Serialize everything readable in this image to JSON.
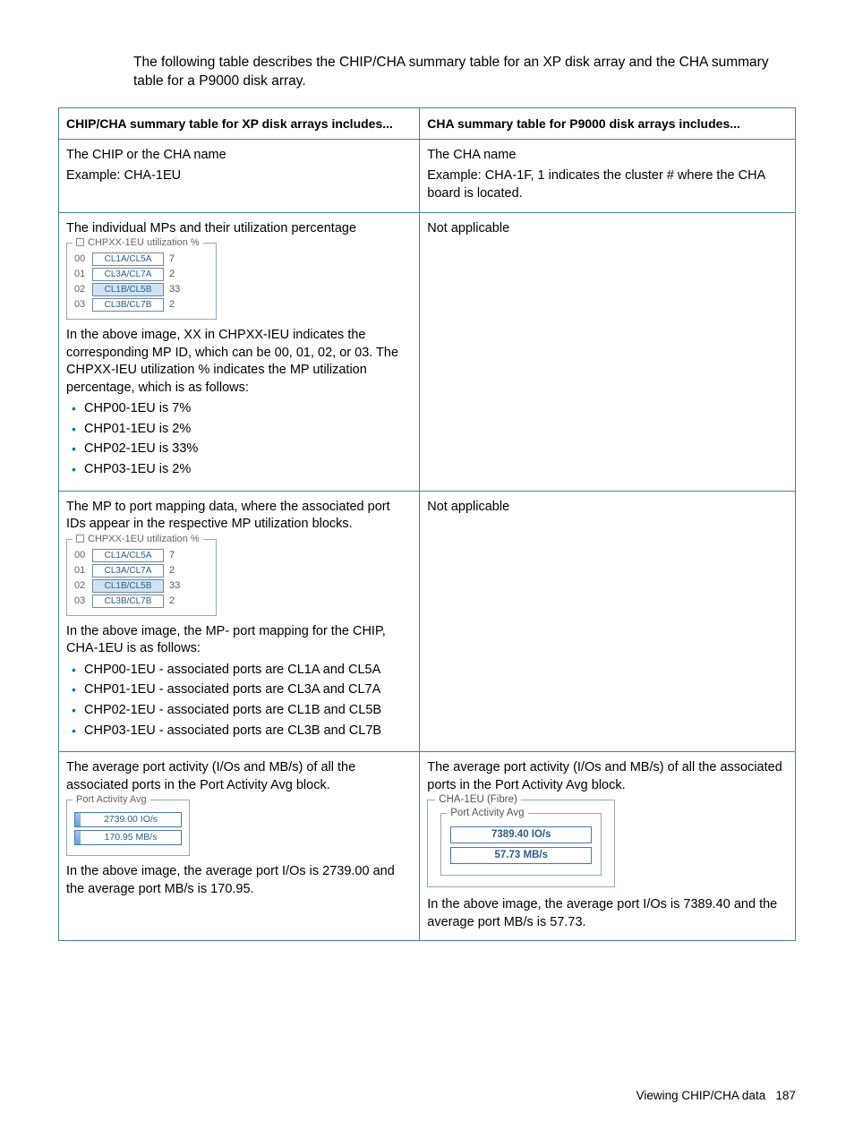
{
  "intro": "The following table describes the CHIP/CHA summary table for an XP disk array and the CHA summary table for a P9000 disk array.",
  "headers": {
    "left": "CHIP/CHA summary table for XP disk arrays includes...",
    "right": "CHA summary table for P9000 disk arrays includes..."
  },
  "row1": {
    "left_line1": "The CHIP or the CHA name",
    "left_line2": "Example: CHA-1EU",
    "right_line1": "The CHA name",
    "right_line2": "Example: CHA-1F, 1 indicates the cluster # where the CHA board is located."
  },
  "row2": {
    "left_intro": "The individual MPs and their utilization percentage",
    "fs_legend": "CHPXX-1EU utilization %",
    "rows": [
      {
        "idx": "00",
        "label": "CL1A/CL5A",
        "val": "7",
        "hl": false
      },
      {
        "idx": "01",
        "label": "CL3A/CL7A",
        "val": "2",
        "hl": false
      },
      {
        "idx": "02",
        "label": "CL1B/CL5B",
        "val": "33",
        "hl": true
      },
      {
        "idx": "03",
        "label": "CL3B/CL7B",
        "val": "2",
        "hl": false
      }
    ],
    "left_para_pre": "In the above image, XX in ",
    "left_para_b1": "CHPXX-IEU",
    "left_para_mid": " indicates the corresponding MP ID, which can be 00, 01, 02, or 03. The ",
    "left_para_b2": "CHPXX-IEU utilization %",
    "left_para_post": " indicates the MP utilization percentage, which is as follows:",
    "bullets": [
      "CHP00-1EU is 7%",
      "CHP01-1EU is 2%",
      "CHP02-1EU is 33%",
      "CHP03-1EU is 2%"
    ],
    "right": "Not applicable"
  },
  "row3": {
    "left_intro": "The MP to port mapping data, where the associated port IDs appear in the respective MP utilization blocks.",
    "left_para": "In the above image, the MP- port mapping for the CHIP, CHA-1EU is as follows:",
    "bullets": [
      "CHP00-1EU - associated ports are CL1A and CL5A",
      "CHP01-1EU - associated ports are CL3A and CL7A",
      "CHP02-1EU - associated ports are CL1B and CL5B",
      "CHP03-1EU - associated ports are CL3B and CL7B"
    ],
    "right": "Not applicable"
  },
  "row4": {
    "left_intro_pre": "The average port activity (I/Os and MB/s) of all the associated ports in the ",
    "left_intro_b": "Port Activity Avg",
    "left_intro_post": " block.",
    "avg_legend": "Port Activity Avg",
    "avg_io": "2739.00 IO/s",
    "avg_mb": "170.95 MB/s",
    "left_after": "In the above image, the average port I/Os is 2739.00 and the average port MB/s is 170.95.",
    "right_intro_pre": "The average port activity (I/Os and MB/s) of all the associated ports in the ",
    "right_intro_b": "Port Activity Avg",
    "right_intro_post": " block.",
    "big_outer_legend": "CHA-1EU (Fibre)",
    "big_inner_legend": "Port Activity Avg",
    "big_io": "7389.40 IO/s",
    "big_mb": "57.73 MB/s",
    "right_after": "In the above image, the average port I/Os is 7389.40 and the average port MB/s is 57.73."
  },
  "footer": {
    "text": "Viewing CHIP/CHA data",
    "page": "187"
  }
}
